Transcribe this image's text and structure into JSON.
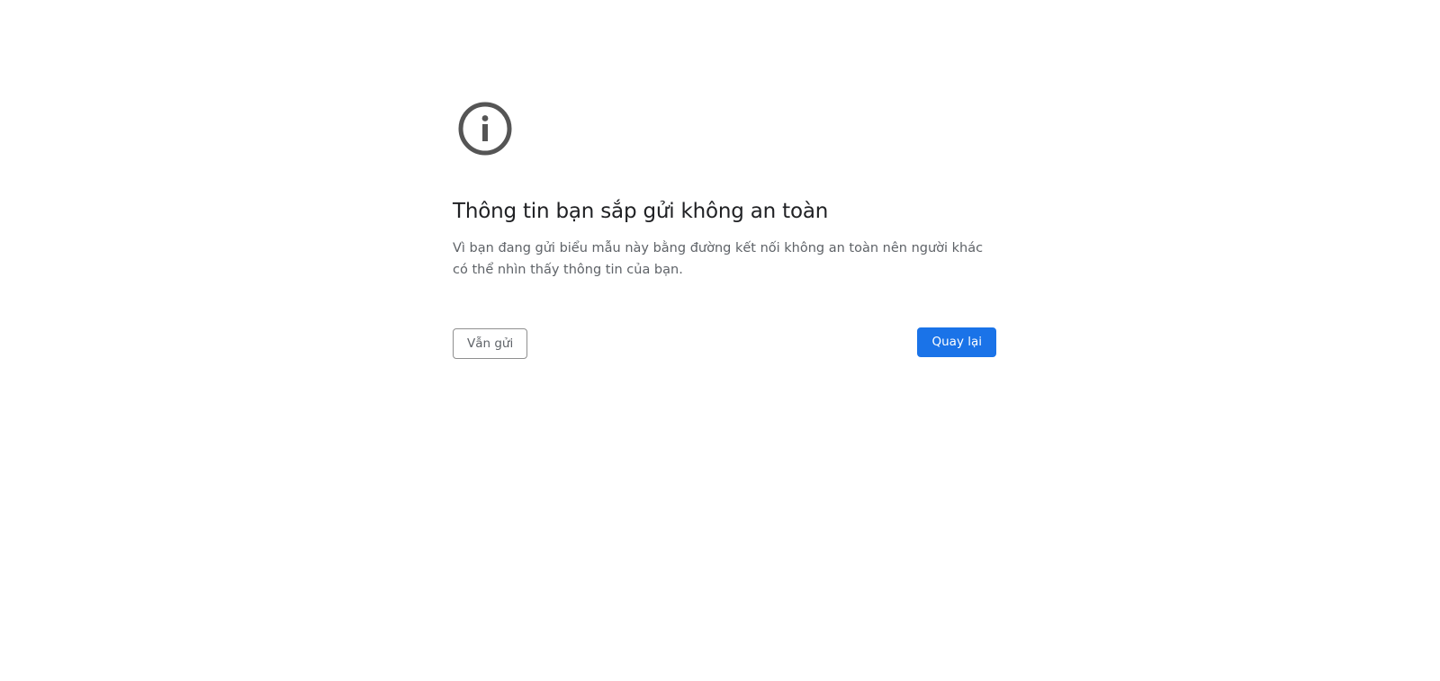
{
  "interstitial": {
    "icon": "info-icon",
    "title": "Thông tin bạn sắp gửi không an toàn",
    "message": "Vì bạn đang gửi biểu mẫu này bằng đường kết nối không an toàn nên người khác có thể nhìn thấy thông tin của bạn.",
    "secondary_button_label": "Vẫn gửi",
    "primary_button_label": "Quay lại"
  },
  "colors": {
    "icon": "#555555",
    "title": "#202124",
    "body_text": "#5f6368",
    "primary_button": "#1a73e8",
    "background": "#ffffff"
  }
}
